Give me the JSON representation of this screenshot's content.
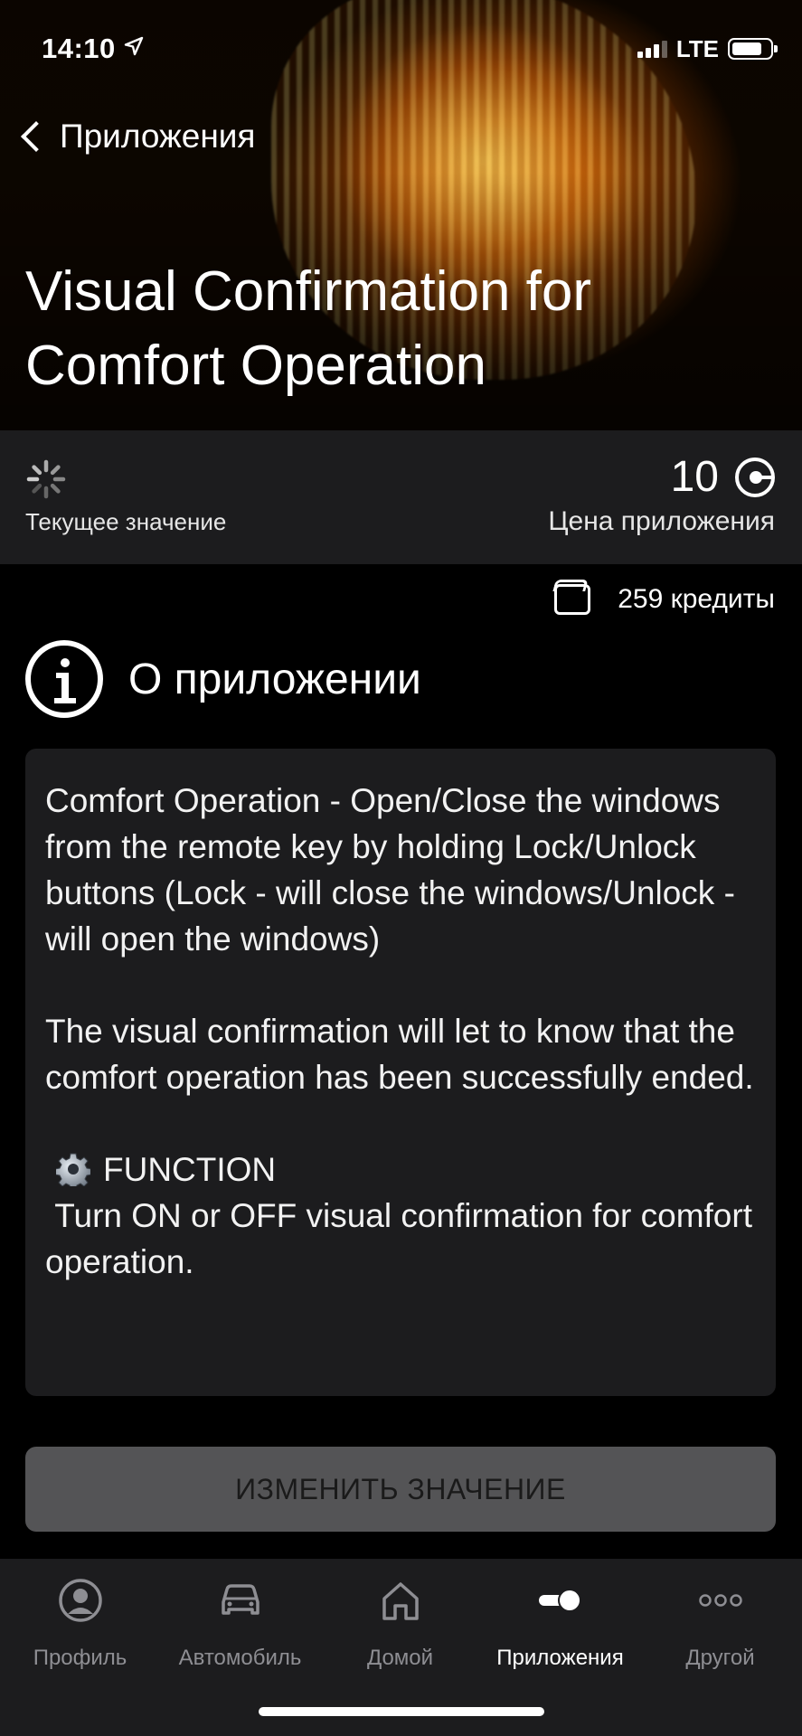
{
  "status_bar": {
    "time": "14:10",
    "network": "LTE"
  },
  "nav": {
    "back_label": "Приложения"
  },
  "app": {
    "title": "Visual Confirmation for Comfort Operation"
  },
  "info": {
    "current_value_label": "Текущее значение",
    "price_value": "10",
    "price_label": "Цена приложения",
    "credits": "259 кредиты"
  },
  "about": {
    "heading": "О приложении",
    "paragraph1": "Comfort Operation - Open/Close the windows from the remote key by holding Lock/Unlock buttons (Lock - will close the windows/Unlock - will open the windows)",
    "paragraph2": "The visual confirmation will let to know that the comfort operation has been successfully ended.",
    "function_title": "FUNCTION",
    "function_text": " Turn ON or OFF visual confirmation for comfort operation."
  },
  "action": {
    "button_label": "ИЗМЕНИТЬ ЗНАЧЕНИЕ"
  },
  "tabs": [
    {
      "label": "Профиль",
      "icon": "profile-icon"
    },
    {
      "label": "Автомобиль",
      "icon": "car-icon"
    },
    {
      "label": "Домой",
      "icon": "home-icon"
    },
    {
      "label": "Приложения",
      "icon": "toggle-icon",
      "active": true
    },
    {
      "label": "Другой",
      "icon": "more-icon"
    }
  ],
  "colors": {
    "background": "#000000",
    "panel": "#1c1c1e",
    "button": "#545456",
    "inactive": "#8e8e93"
  }
}
